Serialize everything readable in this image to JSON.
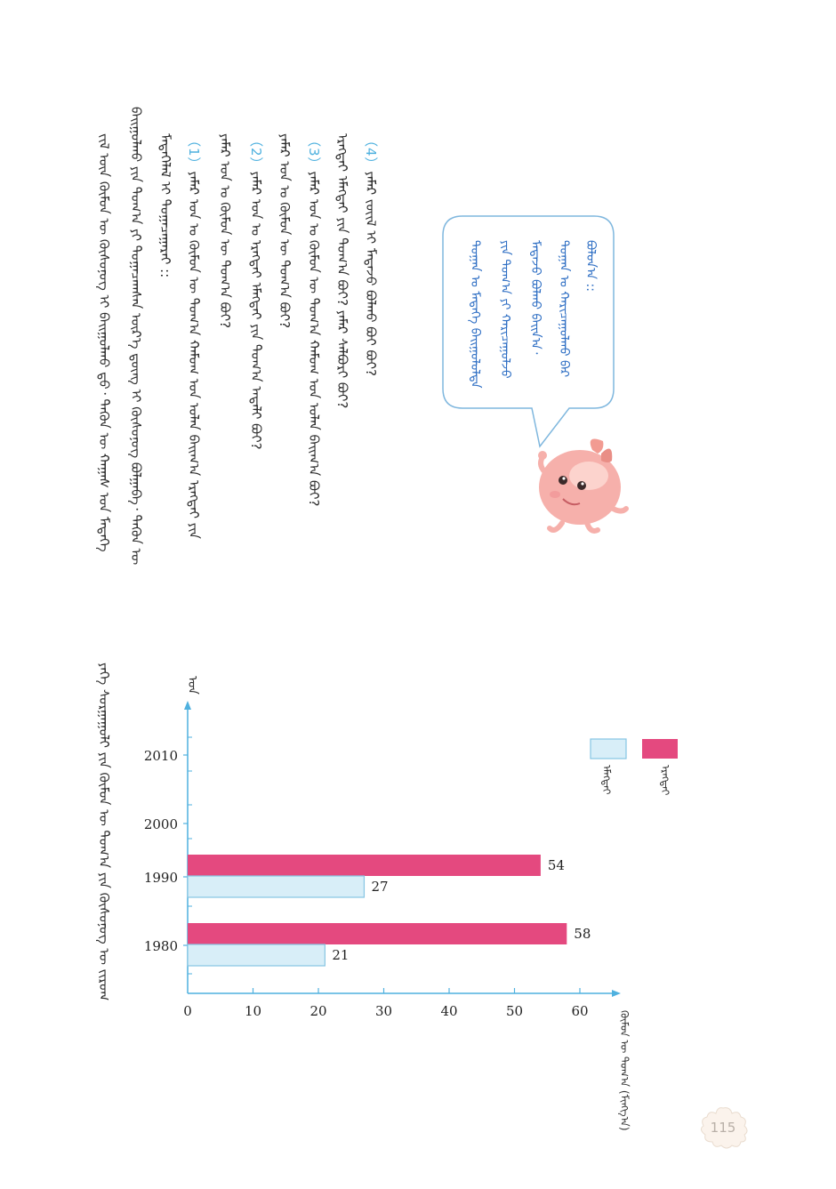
{
  "questions": {
    "q4": {
      "number": "（4）",
      "text_1": "ᠶᠠᠮᠠᠷ ᠵᠦᠢᠯ ᠢ ᠮᠡᠳᠡᠵᠦ ᠪᠣᠯᠬᠤ ᠪᠤᠢ ᠪᠣᠢ?",
      "text_2": "ᠡᠷᠡᠭᠲᠡᠢ ᠡᠮᠡᠭᠲᠡᠢ ᠶᠢᠨ ᠲᠣᠭ᠎ᠠ ᠪᠤᠢ? ᠶᠠᠮᠠᠷ ᠰᠠᠯᠪᠤᠷᠢ ᠪᠤᠢ?"
    },
    "q3": {
      "number": "（3）",
      "text_1": "ᠶᠠᠮᠠᠷ ᠣᠨ ᠤ ᠬᠦᠮᠦᠨ ᠦ ᠲᠣᠭ᠎ᠠ ᠬᠠᠮᠤᠭ ᠤᠨ ᠣᠯᠠᠨ ᠪᠠᠢᠭ᠎ᠠ ᠪᠤᠢ?",
      "text_2": "ᠶᠠᠮᠠᠷ ᠣᠨ ᠤ ᠬᠦᠮᠦᠨ ᠦ ᠲᠣᠭ᠎ᠠ ᠪᠤᠢ?"
    },
    "q2": {
      "number": "（2）",
      "text_1": "ᠶᠠᠮᠠᠷ ᠣᠨ ᠤ ᠡᠷᠡᠭᠲᠡᠢ ᠡᠮᠡᠭᠲᠡᠢ ᠶᠢᠨ ᠲᠣᠭ᠎ᠠ ᠠᠳᠠᠯᠢ ᠪᠤᠢ?",
      "text_2": "ᠶᠠᠮᠠᠷ ᠣᠨ ᠤ ᠬᠦᠮᠦᠨ ᠦ ᠲᠣᠭ᠎ᠠ ᠪᠤᠢ?"
    },
    "q1": {
      "number": "（1）",
      "text_1": "ᠶᠠᠮᠠᠷ ᠣᠨ ᠤ ᠬᠦᠮᠦᠨ ᠦ ᠲᠣᠭ᠎ᠠ ᠬᠠᠮᠤᠭ ᠤᠨ ᠣᠯᠠᠨ ᠪᠠᠢᠭ᠎ᠠ ᠡᠷᠡᠭᠲᠡᠢ ᠶᠢᠨ",
      "text_2": "ᠮᠡᠳᠡᠭᠡᠯᠡᠯ ᠢ ᠲᠣᠭᠠᠴᠠᠭᠠᠷᠠᠢ ::"
    },
    "intro_1": "ᠪᠠᠢᠭᠤᠯᠬᠤ ᠶᠢᠨ ᠲᠣᠭ᠎ᠠ ᠶᠢ ᠲᠣᠭᠠᠴᠠᠭᠰᠠᠨ ᠦᠷ᠎ᠡ ᠳ᠋ᠦᠩ ᠢ ᠬᠦᠰᠦᠨᠦᠭ ᠪᠣᠯᠭᠠᠪᠠ᠂ ᠲᠡᠭᠦᠨ ᠦ",
    "intro_2": "ᠵᠢᠯ ᠦᠨ ᠬᠦᠮᠦᠨ ᠦ ᠬᠦᠰᠦᠨᠦᠭ ᠢ ᠪᠠᠢᠭᠤᠯᠬᠤ ᠳ᠋ᠤ᠂ ᠲᠡᠭᠦᠨ ᠦ ᠬᠠᠭᠠᠰ ᠤᠨ ᠮᠡᠳᠡᠭᠡ"
  },
  "speech_bubble": {
    "line_1": "ᠪᠣᠯᠣᠨ᠎ᠠ ::",
    "line_2": "ᠲᠣᠭᠠᠨ ᠤ ᠬᠠᠷᠢᠴᠠᠭᠤᠯᠬᠤ ᠪᠠᠷ",
    "line_3": "ᠮᠡᠳᠡᠵᠦ ᠪᠣᠯᠬᠤ ᠪᠠᠢᠨ᠎ᠠ᠂",
    "line_4": "ᠶᠢᠨ ᠲᠣᠭ᠎ᠠ ᠶᠢ ᠬᠠᠷᠢᠴᠠᠭᠤᠯᠵᠤ",
    "line_5": "ᠲᠣᠭᠠᠨ ᠤ ᠮᠡᠳᠡᠭᠡ ᠪᠠᠢᠭᠤᠯᠤᠯᠲᠠ"
  },
  "chart_caption": "ᠶᠡᠬᠡ ᠰᠤᠷᠭᠠᠭᠤᠯᠢ ᠶᠢᠨ ᠬᠦᠮᠦᠨ ᠦ ᠲᠣᠭ᠎ᠠ ᠶᠢᠨ ᠬᠦᠰᠦᠨᠦᠭ ᠦ ᠵᠢᠷᠤᠭ",
  "page_number": "115",
  "chart_data": {
    "type": "bar",
    "orientation": "horizontal",
    "categories": [
      "1980",
      "1990",
      "2000",
      "2010"
    ],
    "series": [
      {
        "name": "ᠡᠷᠡᠭᠲᠡᠢ",
        "color": "#e4497f",
        "values": [
          58,
          54,
          null,
          null
        ]
      },
      {
        "name": "ᠡᠮᠡᠭᠲᠡᠢ",
        "color": "#d8eef8",
        "values": [
          21,
          27,
          null,
          null
        ]
      }
    ],
    "value_axis": {
      "ticks": [
        0,
        10,
        20,
        30,
        40,
        50,
        60
      ],
      "label": "ᠬᠦᠮᠦᠨ ᠦ ᠲᠣᠭ᠎ᠠ (ᠮᠢᠩᠭ᠎ᠠ)"
    },
    "category_axis_label": "ᠣᠨ",
    "data_labels": true,
    "legend_position": "top-right",
    "grid": false,
    "axis_color": "#4fb1df"
  }
}
